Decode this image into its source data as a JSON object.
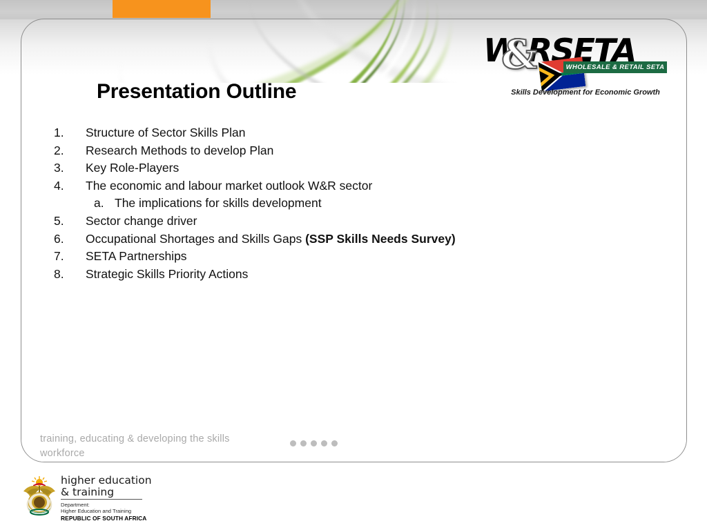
{
  "slide": {
    "title": "Presentation Outline",
    "outline": [
      {
        "number": "1.",
        "text": "Structure of Sector Skills Plan",
        "level": 1
      },
      {
        "number": "2.",
        "text": "Research Methods to develop Plan",
        "level": 1
      },
      {
        "number": "3.",
        "text": "Key Role-Players",
        "level": 1
      },
      {
        "number": "4.",
        "text": "The economic and labour market outlook W&R sector",
        "level": 1
      },
      {
        "number": "a.",
        "text": "The implications for skills development",
        "level": 2
      },
      {
        "number": "5.",
        "text": "Sector change driver",
        "level": 1
      },
      {
        "number": "6.",
        "text": "Occupational Shortages and Skills Gaps ",
        "bold_suffix": "(SSP Skills Needs Survey)",
        "level": 1
      },
      {
        "number": "7.",
        "text": "SETA Partnerships",
        "level": 1
      },
      {
        "number": "8.",
        "text": "Strategic Skills Priority Actions",
        "level": 1
      }
    ]
  },
  "footer": {
    "tagline": "training, educating & developing the skills workforce",
    "dot_count": 5
  },
  "wrseta_logo": {
    "wordmark": "W RSETA",
    "ampersand": "&",
    "banner_text": "WHOLESALE & RETAIL SETA",
    "tagline": "Skills Development for Economic Growth",
    "banner_color": "#1c6b43"
  },
  "dhet_logo": {
    "line1": "higher education",
    "line2": "& training",
    "department_label": "Department:",
    "department_name": "Higher Education and Training",
    "country": "REPUBLIC OF SOUTH AFRICA"
  },
  "decor": {
    "orange_tab_color": "#f7931d",
    "swoosh_green": "#7fae3c",
    "panel_border_color": "#8d8d8d",
    "dot_color": "#bdbdbd"
  }
}
